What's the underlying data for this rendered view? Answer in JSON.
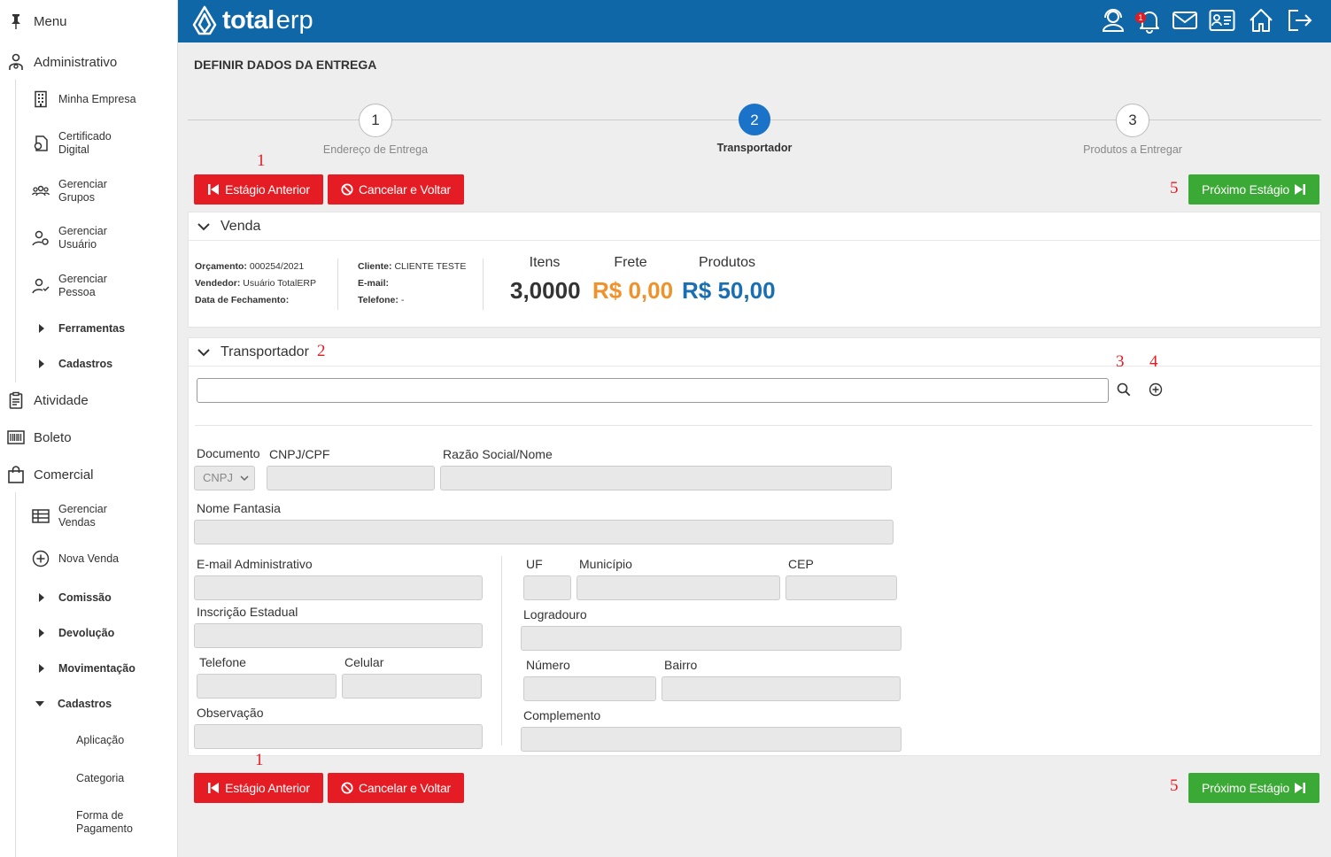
{
  "sidebar": {
    "menu_label": "Menu",
    "administrativo": "Administrativo",
    "admin_items": [
      {
        "line1": "Minha Empresa",
        "line2": ""
      },
      {
        "line1": "Certificado",
        "line2": "Digital"
      },
      {
        "line1": "Gerenciar",
        "line2": "Grupos"
      },
      {
        "line1": "Gerenciar",
        "line2": "Usuário"
      },
      {
        "line1": "Gerenciar",
        "line2": "Pessoa"
      }
    ],
    "ferramentas": "Ferramentas",
    "cadastros_admin": "Cadastros",
    "atividade": "Atividade",
    "boleto": "Boleto",
    "comercial": "Comercial",
    "comercial_items": [
      {
        "line1": "Gerenciar",
        "line2": "Vendas"
      },
      {
        "line1": "Nova Venda",
        "line2": ""
      }
    ],
    "comissao": "Comissão",
    "devolucao": "Devolução",
    "movimentacao": "Movimentação",
    "cadastros_comercial": "Cadastros",
    "cadastros_items": [
      {
        "line1": "Aplicação",
        "line2": ""
      },
      {
        "line1": "Categoria",
        "line2": ""
      },
      {
        "line1": "Forma de",
        "line2": "Pagamento"
      }
    ]
  },
  "header": {
    "logo_bold": "total",
    "logo_light": "erp",
    "notification_count": "1",
    "brand_color": "#0f67a8"
  },
  "page": {
    "title": "DEFINIR DADOS DA ENTREGA"
  },
  "steps": [
    {
      "number": "1",
      "label": "Endereço de Entrega"
    },
    {
      "number": "2",
      "label": "Transportador"
    },
    {
      "number": "3",
      "label": "Produtos a Entregar"
    }
  ],
  "buttons": {
    "previous": "Estágio Anterior",
    "cancel": "Cancelar e Voltar",
    "next": "Próximo Estágio"
  },
  "annotations": {
    "m1": "1",
    "m2": "2",
    "m3": "3",
    "m4": "4",
    "m5": "5"
  },
  "venda": {
    "title": "Venda",
    "orcamento_label": "Orçamento:",
    "orcamento_value": "000254/2021",
    "vendedor_label": "Vendedor:",
    "vendedor_value": "Usuário TotalERP",
    "fechamento_label": "Data de Fechamento:",
    "cliente_label": "Cliente:",
    "cliente_value": "CLIENTE TESTE",
    "email_label": "E-mail:",
    "telefone_label": "Telefone:",
    "telefone_value": "-",
    "itens_label": "Itens",
    "itens_value": "3,0000",
    "frete_label": "Frete",
    "frete_value": "R$ 0,00",
    "produtos_label": "Produtos",
    "produtos_value": "R$ 50,00",
    "colors": {
      "itens": "#333333",
      "frete": "#f0922b",
      "produtos": "#1a6fb3"
    }
  },
  "transportador": {
    "title": "Transportador",
    "search_value": "",
    "documento_label": "Documento",
    "documento_value": "CNPJ",
    "cnpj_label": "CNPJ/CPF",
    "razao_label": "Razão Social/Nome",
    "fantasia_label": "Nome Fantasia",
    "email_label": "E-mail Administrativo",
    "ie_label": "Inscrição Estadual",
    "telefone_label": "Telefone",
    "celular_label": "Celular",
    "obs_label": "Observação",
    "uf_label": "UF",
    "municipio_label": "Município",
    "cep_label": "CEP",
    "logradouro_label": "Logradouro",
    "numero_label": "Número",
    "bairro_label": "Bairro",
    "complemento_label": "Complemento"
  }
}
